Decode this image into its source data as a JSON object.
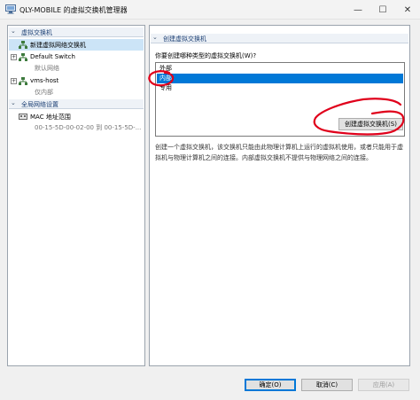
{
  "window": {
    "title": "QLY-MOBILE 的虚拟交换机管理器",
    "minimize_glyph": "—",
    "maximize_glyph": "☐",
    "close_glyph": "✕"
  },
  "left_panel": {
    "section1": {
      "chevron": "⌄",
      "label": "虚拟交换机"
    },
    "items": [
      {
        "label": "新建虚拟网络交换机",
        "selected": true
      },
      {
        "expander": "+",
        "label": "Default Switch",
        "sub": "默认网络"
      },
      {
        "expander": "+",
        "label": "vms-host",
        "sub": "仅内部"
      }
    ],
    "section2": {
      "chevron": "⌄",
      "label": "全局网络设置"
    },
    "mac": {
      "label": "MAC 地址范围",
      "sub": "00-15-5D-00-02-00 到 00-15-5D-..."
    }
  },
  "right_panel": {
    "header": {
      "chevron": "⌄",
      "label": "创建虚拟交换机"
    },
    "prompt": "你要创建哪种类型的虚拟交换机(W)?",
    "options": [
      "外部",
      "内部",
      "专用"
    ],
    "selected_option": "内部",
    "create_button": "创建虚拟交换机(S)",
    "description": "创建一个虚拟交换机，该交换机只能由此物理计算机上运行的虚拟机使用，或者只能用于虚拟机与物理计算机之间的连接。内部虚拟交换机不提供与物理网络之间的连接。"
  },
  "footer": {
    "ok": "确定(O)",
    "cancel": "取消(C)",
    "apply": "应用(A)"
  },
  "colors": {
    "selection": "#0078d7",
    "tree_selection": "#cce4f7",
    "annotation": "#e0001b",
    "header_text": "#1a3e73"
  }
}
